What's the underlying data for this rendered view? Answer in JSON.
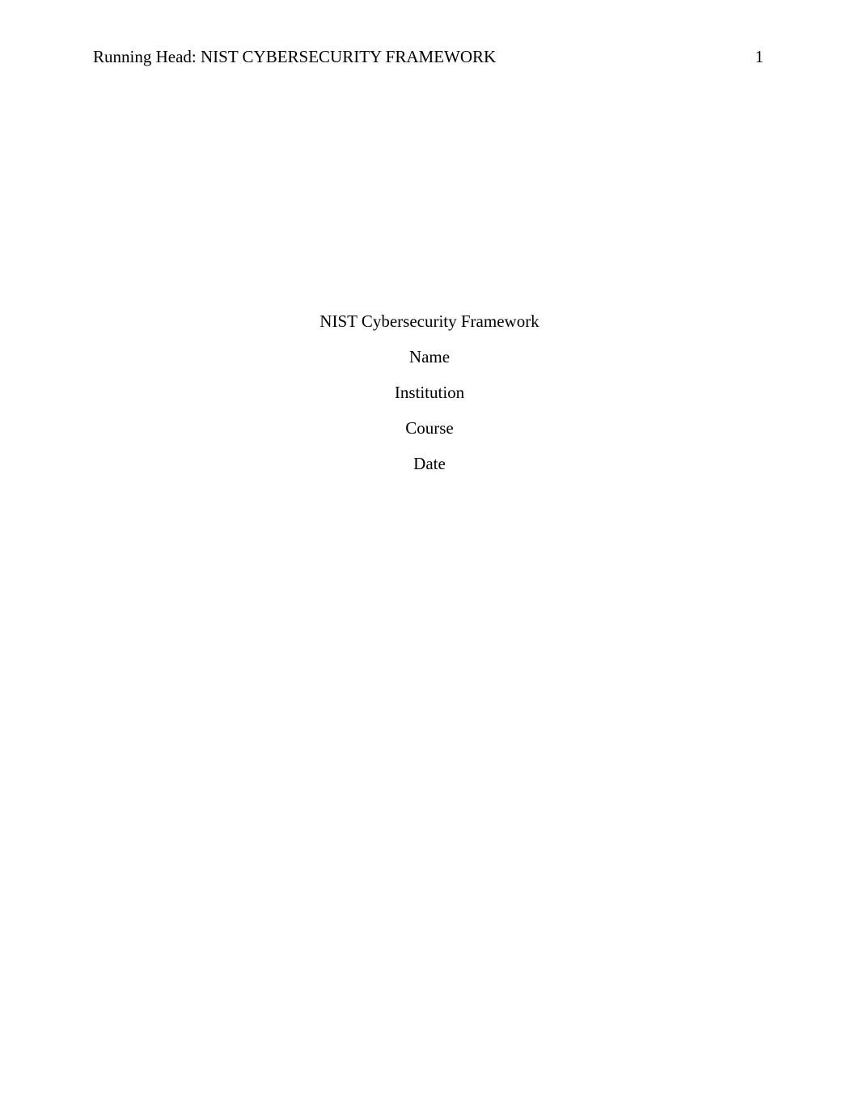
{
  "header": {
    "running_head": "Running Head: NIST CYBERSECURITY FRAMEWORK",
    "page_number": "1"
  },
  "title_block": {
    "title": "NIST Cybersecurity Framework",
    "name": "Name",
    "institution": "Institution",
    "course": "Course",
    "date": "Date"
  }
}
